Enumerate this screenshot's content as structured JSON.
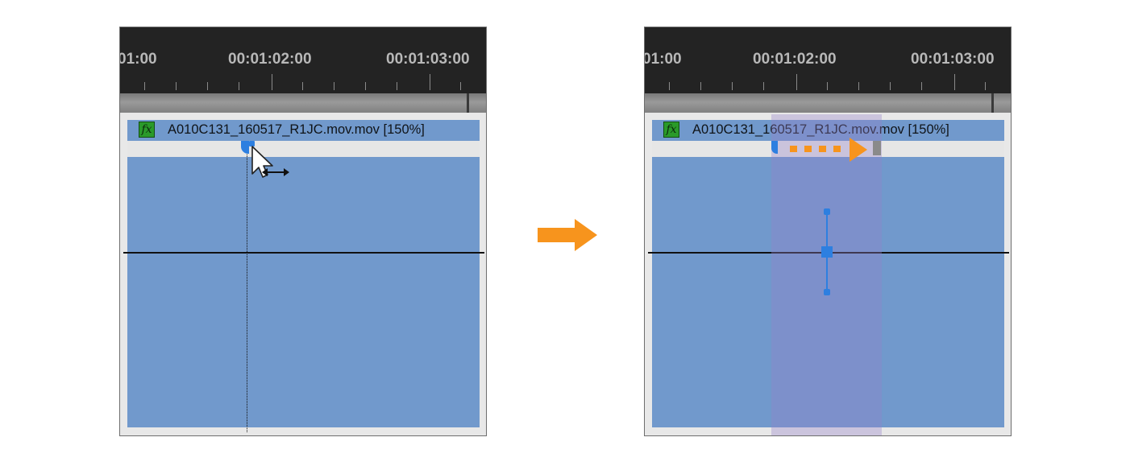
{
  "before": {
    "timecodes": [
      "01:00",
      "00:01:02:00",
      "00:01:03:00"
    ],
    "clip": {
      "fx_label": "fx",
      "name": "A010C131_160517_R1JC.mov.mov [150%]"
    }
  },
  "after": {
    "timecodes": [
      "01:00",
      "00:01:02:00",
      "00:01:03:00"
    ],
    "clip": {
      "fx_label": "fx",
      "name": "A010C131_160517_R1JC.mov.mov [150%]"
    }
  },
  "colors": {
    "accent_orange": "#f7941d",
    "clip_blue": "#7199cc",
    "keyframe_blue": "#2d7fe0",
    "ruler_bg": "#232323"
  },
  "icons": [
    "fx-icon",
    "mouse-pointer-icon",
    "resize-horizontal-icon",
    "right-arrow-icon",
    "dotted-arrow-icon"
  ]
}
